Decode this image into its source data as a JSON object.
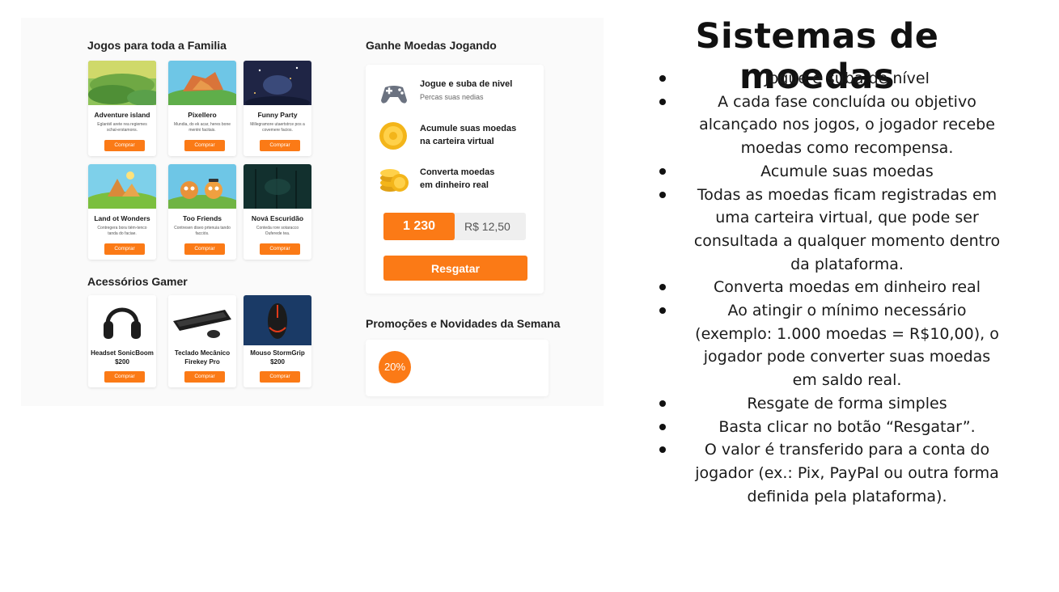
{
  "mockup": {
    "family_section_title": "Jogos para toda a Familia",
    "games": [
      {
        "name": "Adventure island",
        "desc": "Eglantél arete rea regiemes schal-erstamons.",
        "button": "Comprar"
      },
      {
        "name": "Pixellero",
        "desc": "Mundia, do ek acar, heres bone mentni facitais.",
        "button": "Comprar"
      },
      {
        "name": "Funny Party",
        "desc": "Millegramore utaertstrce pos a covemere facios.",
        "button": "Comprar"
      },
      {
        "name": "Land ot Wonders",
        "desc": "Contregera bora tiém-tenco tanda do faciae.",
        "button": "Comprar"
      },
      {
        "name": "Too Friends",
        "desc": "Contresen diseo prtenuia tando facciós.",
        "button": "Comprar"
      },
      {
        "name": "Nová Escuridão",
        "desc": "Conteda rore sotaracco Ouferede tea.",
        "button": "Comprar"
      }
    ],
    "accessories_section_title": "Acessórios Gamer",
    "accessories": [
      {
        "name_line1": "Headset SonicBoom",
        "name_line2": "$200",
        "button": "Comprar"
      },
      {
        "name_line1": "Teclado Mecânico",
        "name_line2": "Firekey Pro",
        "button": "Comprar"
      },
      {
        "name_line1": "Mouso StormGrip",
        "name_line2": "$200",
        "button": "Comprar"
      }
    ],
    "coins_section_title": "Ganhe Moedas Jogando",
    "steps": [
      {
        "title_line1": "Jogue e suba de nivel",
        "title_line2": "",
        "subtitle": "Percas suas nedias",
        "icon": "gamepad-icon"
      },
      {
        "title_line1": "Acumule suas moedas",
        "title_line2": "na carteira virtual",
        "subtitle": "",
        "icon": "coin-icon"
      },
      {
        "title_line1": "Converta moedas",
        "title_line2": "em dinheiro real",
        "subtitle": "",
        "icon": "coin-stack-icon"
      }
    ],
    "coin_balance": "1 230",
    "money_balance": "R$ 12,50",
    "redeem_button": "Resgatar",
    "promo_section_title": "Promoções e Novidades da Semana",
    "promo_badge": "20%",
    "accent_color": "#fb7a16"
  },
  "slide": {
    "title": "Sistemas de moedas",
    "bullets": [
      [
        "Jogue e suba de nível"
      ],
      [
        "A cada fase concluída ou objetivo",
        "alcançado nos jogos, o jogador recebe",
        "moedas como recompensa."
      ],
      [
        "Acumule suas moedas"
      ],
      [
        "Todas as moedas ficam registradas em",
        "uma carteira virtual, que pode ser",
        "consultada a qualquer momento dentro",
        "da plataforma."
      ],
      [
        "Converta moedas em dinheiro real"
      ],
      [
        "Ao atingir o mínimo necessário",
        "(exemplo: 1.000 moedas = R$10,00), o",
        "jogador pode converter suas moedas",
        "em saldo real."
      ],
      [
        "Resgate de forma simples"
      ],
      [
        "Basta clicar no botão “Resgatar”."
      ],
      [
        "O valor é transferido para a conta do",
        "jogador (ex.: Pix, PayPal ou outra forma",
        "definida pela plataforma)."
      ]
    ]
  }
}
